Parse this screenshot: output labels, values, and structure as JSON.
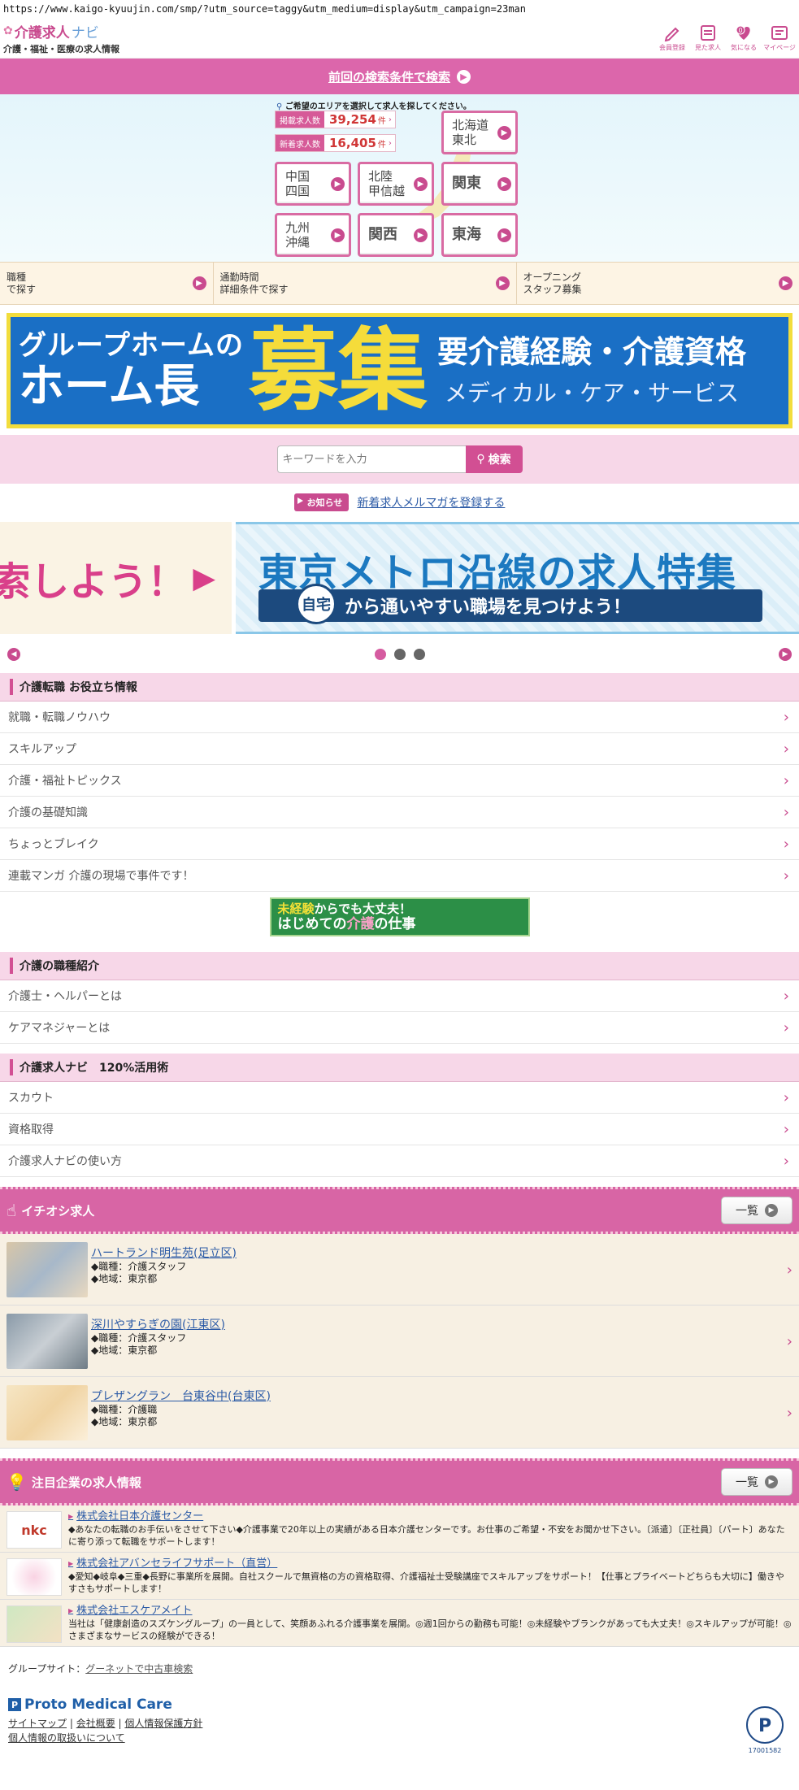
{
  "url": "https://www.kaigo-kyuujin.com/smp/?utm_source=taggy&utm_medium=display&utm_campaign=23man",
  "header": {
    "logo_main": "介護求人",
    "logo_sub_name": "ナビ",
    "logo_tagline": "介護・福祉・医療の求人情報",
    "nav": [
      {
        "label": "会員登録",
        "icon": "pencil-icon"
      },
      {
        "label": "見た求人",
        "icon": "calendar-icon"
      },
      {
        "label": "気になる",
        "icon": "heart-icon",
        "badge": "0"
      },
      {
        "label": "マイページ",
        "icon": "mypage-icon"
      }
    ]
  },
  "prev_search": {
    "label": "前回の検索条件で検索"
  },
  "area": {
    "hint": "ご希望のエリアを選択して求人を探してください。",
    "stats": [
      {
        "label": "掲載求人数",
        "value": "39,254",
        "unit": "件"
      },
      {
        "label": "新着求人数",
        "value": "16,405",
        "unit": "件"
      }
    ],
    "regions": {
      "hokkaido": "北海道\n東北",
      "chugoku": "中国\n四国",
      "hokuriku": "北陸\n甲信越",
      "kanto": "関東",
      "kyushu": "九州\n沖縄",
      "kansai": "関西",
      "tokai": "東海"
    }
  },
  "search_cats": [
    {
      "label": "職種\nで探す"
    },
    {
      "label": "通勤時間\n詳細条件で探す"
    },
    {
      "label": "オープニング\nスタッフ募集"
    }
  ],
  "banner": {
    "line1": "グループホームの",
    "line2": "ホーム長",
    "big": "募集",
    "right1": "要介護経験・介護資格",
    "right2": "メディカル・ケア・サービス"
  },
  "keyword": {
    "placeholder": "キーワードを入力",
    "button": "検索"
  },
  "notice": {
    "badge": "お知らせ",
    "link": "新着求人メルマガを登録する"
  },
  "slider": {
    "prev_text": "検索しよう！",
    "title": "東京メトロ沿線の求人特集",
    "home": "自宅",
    "sub": "から通いやすい職場を見つけよう！"
  },
  "sections": {
    "useful": {
      "title": "介護転職 お役立ち情報",
      "items": [
        "就職・転職ノウハウ",
        "スキルアップ",
        "介護・福祉トピックス",
        "介護の基礎知識",
        "ちょっとブレイク",
        "連載マンガ 介護の現場で事件です！"
      ]
    },
    "promo": {
      "l1a": "未経験",
      "l1b": "からでも大丈夫！",
      "l2a": "はじめての",
      "l2b": "介護",
      "l2c": "の仕事"
    },
    "jobtypes": {
      "title": "介護の職種紹介",
      "items": [
        "介護士・ヘルパーとは",
        "ケアマネジャーとは"
      ]
    },
    "navi": {
      "title": "介護求人ナビ　120%活用術",
      "items": [
        "スカウト",
        "資格取得",
        "介護求人ナビの使い方"
      ]
    }
  },
  "featured": {
    "title": "イチオシ求人",
    "list_button": "一覧",
    "jobs": [
      {
        "name": "ハートランド明生苑(足立区)",
        "type": "◆職種：介護スタッフ",
        "area": "◆地域：東京都"
      },
      {
        "name": "深川やすらぎの園(江東区)",
        "type": "◆職種：介護スタッフ",
        "area": "◆地域：東京都"
      },
      {
        "name": "プレザングラン　台東谷中(台東区)",
        "type": "◆職種：介護職",
        "area": "◆地域：東京都"
      }
    ]
  },
  "companies": {
    "title": "注目企業の求人情報",
    "list_button": "一覧",
    "items": [
      {
        "name": "株式会社日本介護センター",
        "logo": "nkc",
        "desc": "◆あなたの転職のお手伝いをさせて下さい◆介護事業で20年以上の実績がある日本介護センターです。お仕事のご希望・不安をお聞かせ下さい。〔派遣〕〔正社員〕〔パート〕あなたに寄り添って転職をサポートします！"
      },
      {
        "name": "株式会社アバンセライフサポート（直営）",
        "logo": "",
        "desc": "◆愛知◆岐阜◆三重◆長野に事業所を展開。自社スクールで無資格の方の資格取得、介護福祉士受験講座でスキルアップをサポート！【仕事とプライベートどちらも大切に】働きやすさもサポートします！"
      },
      {
        "name": "株式会社エスケアメイト",
        "logo": "",
        "desc": "当社は「健康創造のスズケングループ」の一員として、笑顔あふれる介護事業を展開。◎週1回からの勤務も可能！◎未経験やブランクがあっても大丈夫！◎スキルアップが可能！◎さまざまなサービスの経験ができる！"
      }
    ]
  },
  "footer": {
    "group_label": "グループサイト：",
    "group_link": "グーネットで中古車検索",
    "brand": "Proto Medical Care",
    "links": [
      "サイトマップ",
      "会社概要",
      "個人情報保護方針",
      "個人情報の取扱いについて"
    ],
    "privacy_no": "17001582"
  },
  "colors": {
    "accent": "#d24f93",
    "pink_bg": "#f7d7e8",
    "link": "#2b5aa6"
  }
}
